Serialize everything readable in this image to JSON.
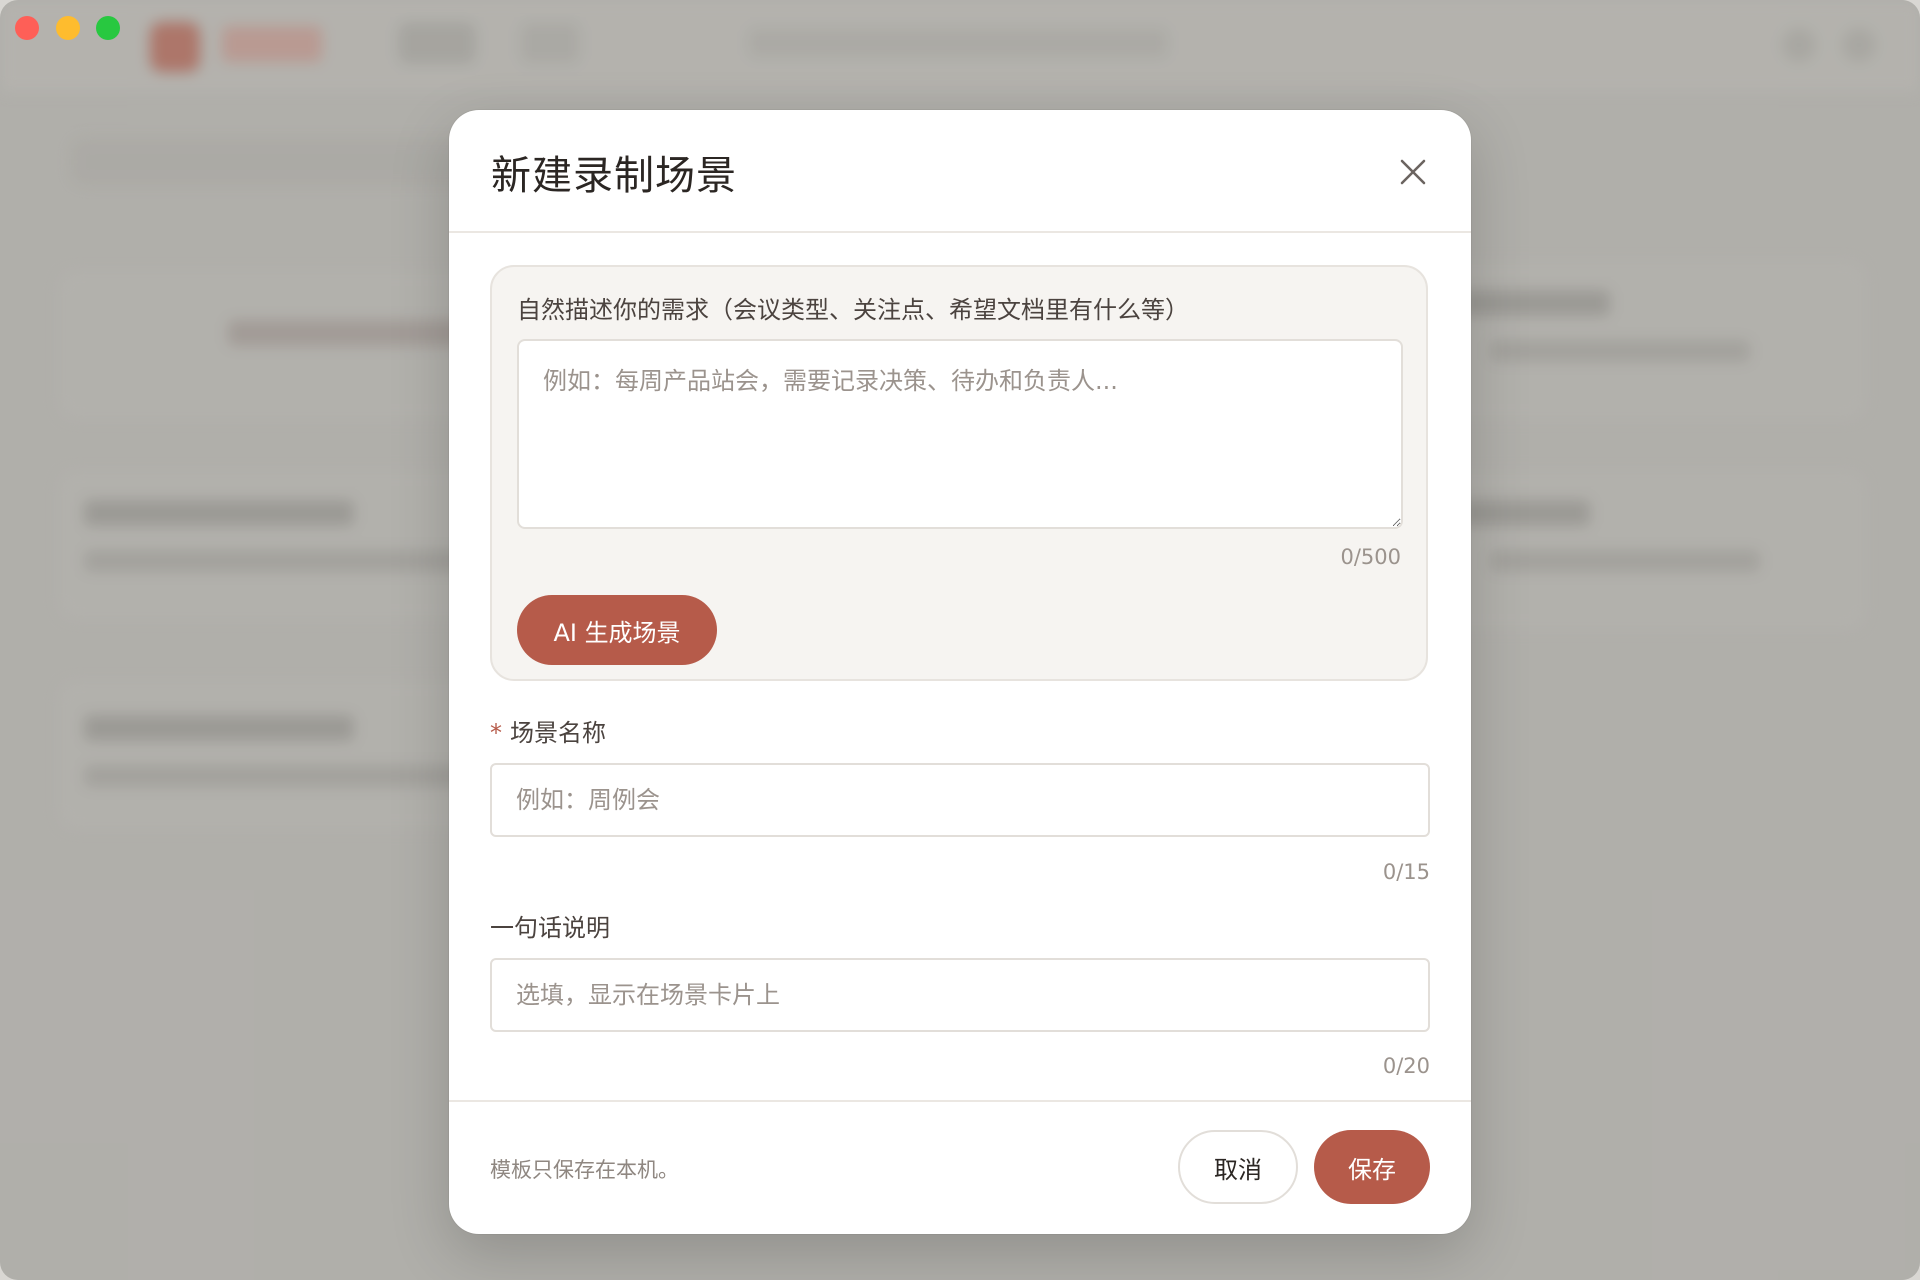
{
  "modal": {
    "title": "新建录制场景",
    "ai_panel": {
      "label": "自然描述你的需求（会议类型、关注点、希望文档里有什么等）",
      "textarea_value": "",
      "textarea_placeholder": "例如：每周产品站会，需要记录决策、待办和负责人...",
      "counter": "0/500",
      "generate_button": "AI 生成场景"
    },
    "scene_name": {
      "required_mark": "*",
      "label": "场景名称",
      "value": "",
      "placeholder": "例如：周例会",
      "counter": "0/15"
    },
    "summary": {
      "label": "一句话说明",
      "value": "",
      "placeholder": "选填，显示在场景卡片上",
      "counter": "0/20"
    },
    "footer": {
      "note": "模板只保存在本机。",
      "cancel_label": "取消",
      "save_label": "保存"
    }
  },
  "window_controls": {
    "close_color": "#fe5f57",
    "minimize_color": "#febc2e",
    "zoom_color": "#28c840"
  },
  "theme": {
    "accent": "#b65b4a"
  }
}
